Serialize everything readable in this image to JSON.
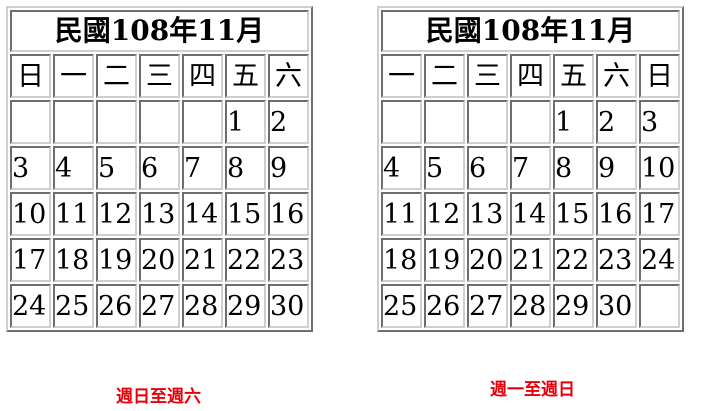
{
  "calendars": [
    {
      "title": "民國108年11月",
      "weekdays": [
        "日",
        "一",
        "二",
        "三",
        "四",
        "五",
        "六"
      ],
      "weeks": [
        [
          "",
          "",
          "",
          "",
          "",
          "1",
          "2"
        ],
        [
          "3",
          "4",
          "5",
          "6",
          "7",
          "8",
          "9"
        ],
        [
          "10",
          "11",
          "12",
          "13",
          "14",
          "15",
          "16"
        ],
        [
          "17",
          "18",
          "19",
          "20",
          "21",
          "22",
          "23"
        ],
        [
          "24",
          "25",
          "26",
          "27",
          "28",
          "29",
          "30"
        ]
      ],
      "caption": "週日至週六",
      "caption_color": "#e8000b"
    },
    {
      "title": "民國108年11月",
      "weekdays": [
        "一",
        "二",
        "三",
        "四",
        "五",
        "六",
        "日"
      ],
      "weeks": [
        [
          "",
          "",
          "",
          "",
          "1",
          "2",
          "3"
        ],
        [
          "4",
          "5",
          "6",
          "7",
          "8",
          "9",
          "10"
        ],
        [
          "11",
          "12",
          "13",
          "14",
          "15",
          "16",
          "17"
        ],
        [
          "18",
          "19",
          "20",
          "21",
          "22",
          "23",
          "24"
        ],
        [
          "25",
          "26",
          "27",
          "28",
          "29",
          "30",
          ""
        ]
      ],
      "caption": "週一至週日",
      "caption_color": "#e8000b"
    }
  ]
}
